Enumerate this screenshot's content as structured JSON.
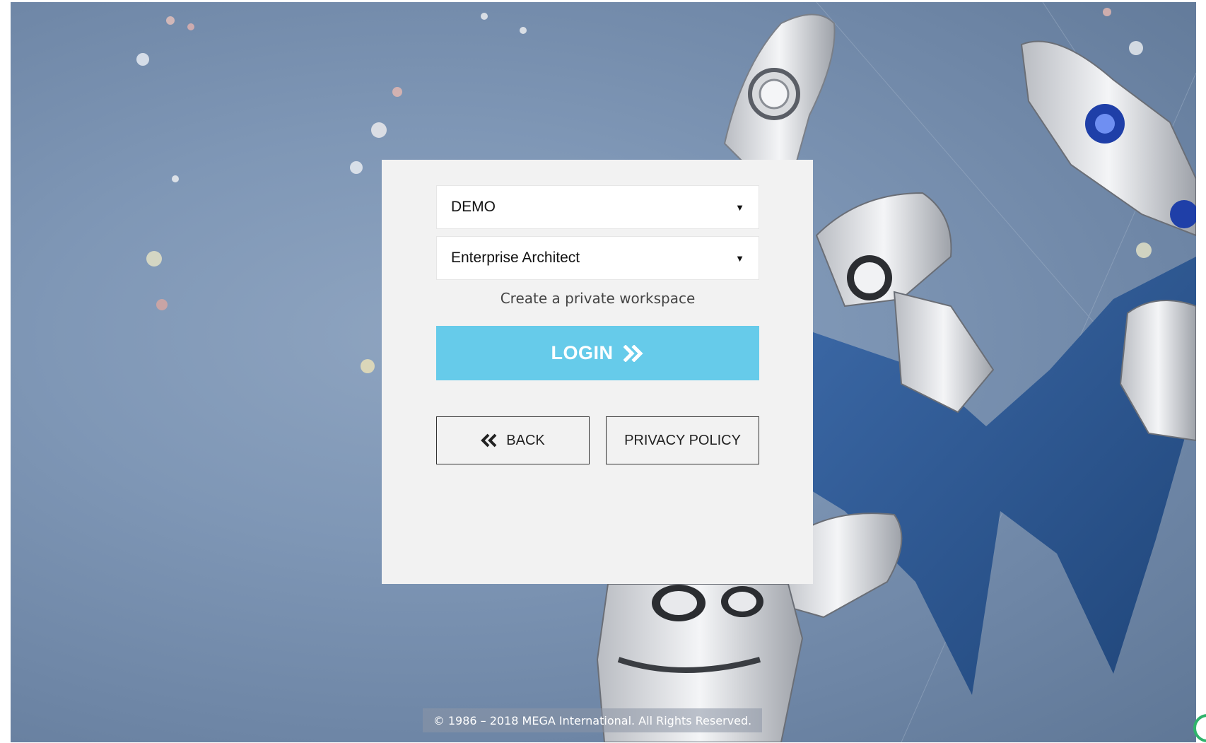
{
  "login": {
    "database": "DEMO",
    "profile": "Enterprise Architect",
    "workspace_link": "Create a private workspace",
    "login_label": "LOGIN",
    "back_label": "BACK",
    "privacy_label": "PRIVACY POLICY"
  },
  "footer": {
    "copyright": "© 1986 – 2018 MEGA International. All Rights Reserved."
  },
  "colors": {
    "login_button": "#66cbea",
    "panel_bg": "#f2f2f2",
    "background": "#7f97b6"
  },
  "icons": {
    "login": "double-chevron-right-icon",
    "back": "double-chevron-left-icon",
    "dropdown": "caret-down-icon"
  }
}
